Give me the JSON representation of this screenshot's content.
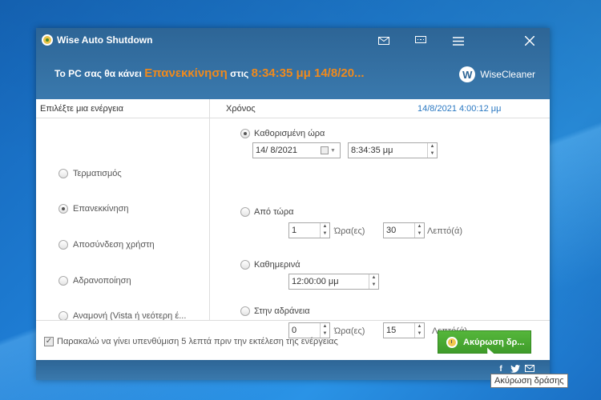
{
  "window": {
    "title": "Wise Auto Shutdown",
    "status_prefix": "Το PC σας θα κάνει",
    "status_action": "Επανεκκίνηση",
    "status_middle": "στις",
    "status_time": "8:34:35 μμ 14/8/20...",
    "brand": "WiseCleaner",
    "brand_logo": "W"
  },
  "header": {
    "left_label": "Επιλέξτε μια ενέργεια",
    "time_label": "Χρόνος",
    "current_datetime": "14/8/2021 4:00:12 μμ"
  },
  "actions": [
    {
      "label": "Τερματισμός",
      "checked": false
    },
    {
      "label": "Επανεκκίνηση",
      "checked": true
    },
    {
      "label": "Αποσύνδεση χρήστη",
      "checked": false
    },
    {
      "label": "Αδρανοποίηση",
      "checked": false
    },
    {
      "label": "Αναμονή (Vista ή νεότερη έ...",
      "checked": false
    }
  ],
  "time_options": {
    "specified": {
      "label": "Καθορισμένη ώρα",
      "date": "14/  8/2021",
      "time": "8:34:35 μμ"
    },
    "from_now": {
      "label": "Από τώρα",
      "hours": "1",
      "hours_unit": "Ώρα(ες)",
      "minutes": "30",
      "minutes_unit": "Λεπτό(ά)"
    },
    "daily": {
      "label": "Καθημερινά",
      "time": "12:00:00 μμ"
    },
    "idle": {
      "label": "Στην αδράνεια",
      "hours": "0",
      "hours_unit": "Ώρα(ες)",
      "minutes": "15",
      "minutes_unit": "Λεπτό(ά)"
    }
  },
  "footer": {
    "reminder": "Παρακαλώ να γίνει υπενθύμιση 5 λεπτά πριν την εκτέλεση της ενέργειας",
    "cancel_button": "Ακύρωση δρ...",
    "tooltip": "Ακύρωση δράσης"
  },
  "colors": {
    "accent": "#f08a1c",
    "titlebar": "#2d6596",
    "button_green": "#4aa932",
    "date_blue": "#2a78c2"
  }
}
